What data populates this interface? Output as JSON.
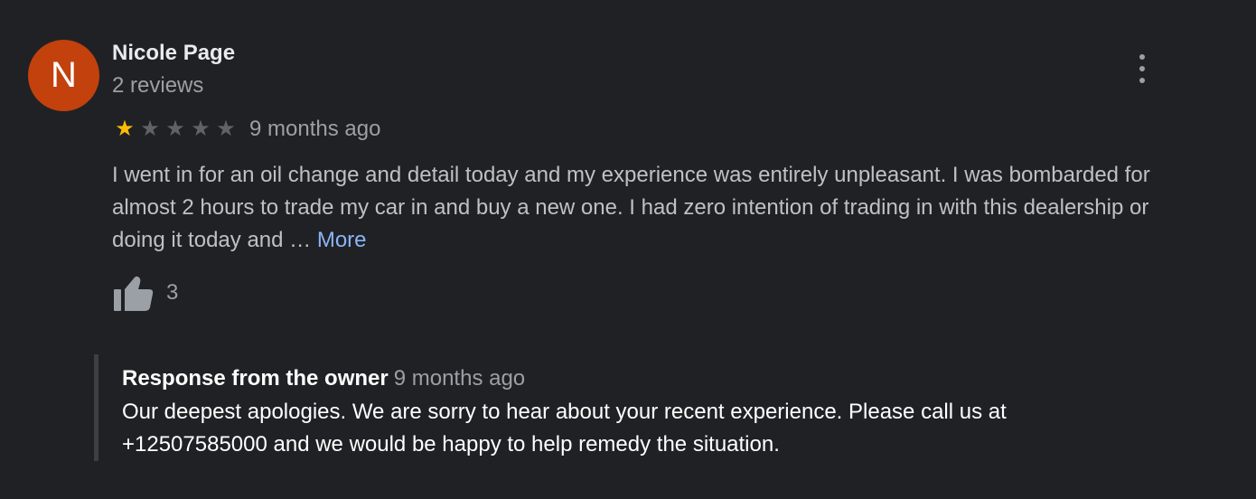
{
  "reviewer": {
    "initial": "N",
    "name": "Nicole Page",
    "review_count": "2 reviews"
  },
  "rating": {
    "value": 1,
    "max": 5,
    "time": "9 months ago"
  },
  "review": {
    "text": "I went in for an oil change and detail today and my experience was entirely unpleasant. I was bombarded for almost 2 hours to trade my car in and buy a new one. I had zero intention of trading in with this dealership or doing it today and … ",
    "more_label": "More"
  },
  "likes": {
    "count": "3"
  },
  "owner_response": {
    "label": "Response from the owner",
    "time": "9 months ago",
    "text": "Our deepest apologies. We are sorry to hear about your recent experience. Please call us at +12507585000 and we would be happy to help remedy the situation."
  },
  "icons": {
    "more": "more-vert-icon",
    "like": "thumb-up-icon",
    "star": "star-icon"
  },
  "colors": {
    "background": "#202124",
    "avatar": "#c2410c",
    "star_filled": "#fbbc04",
    "star_empty": "#5f6368",
    "link": "#8ab4f8"
  }
}
